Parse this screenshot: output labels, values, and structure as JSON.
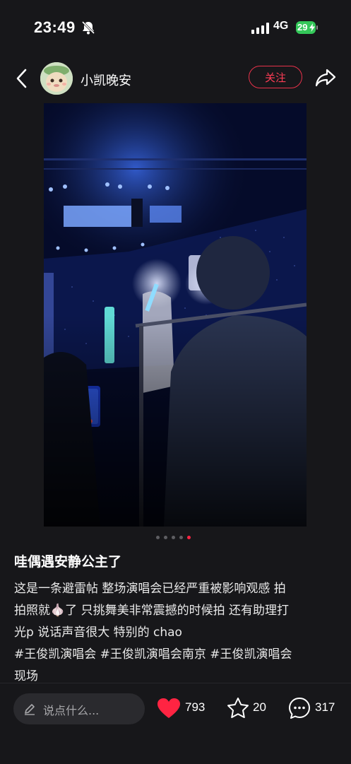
{
  "status": {
    "time": "23:49",
    "network": "4G",
    "battery": "29",
    "icons": [
      "bell-mute-icon",
      "signal-icon",
      "battery-charging-icon"
    ]
  },
  "nav": {
    "username": "小凯晚安",
    "follow_label": "关注",
    "icons": [
      "back-arrow-icon",
      "share-icon"
    ]
  },
  "carousel": {
    "total": 5,
    "current": 5
  },
  "post": {
    "title": "哇偶遇安静公主了",
    "body_lines": [
      "这是一条避雷帖 整场演唱会已经严重被影响观感 拍",
      "拍照就🧄了 只挑舞美非常震撼的时候拍 还有助理打",
      "光p 说话声音很大 特别的 chao"
    ],
    "tags_lines": [
      "#王俊凯演唱会 #王俊凯演唱会南京 #王俊凯演唱会",
      "现场"
    ]
  },
  "bottom": {
    "comment_placeholder": "说点什么...",
    "likes": "793",
    "favorites": "20",
    "comments": "317",
    "like_color": "#ff2442"
  }
}
